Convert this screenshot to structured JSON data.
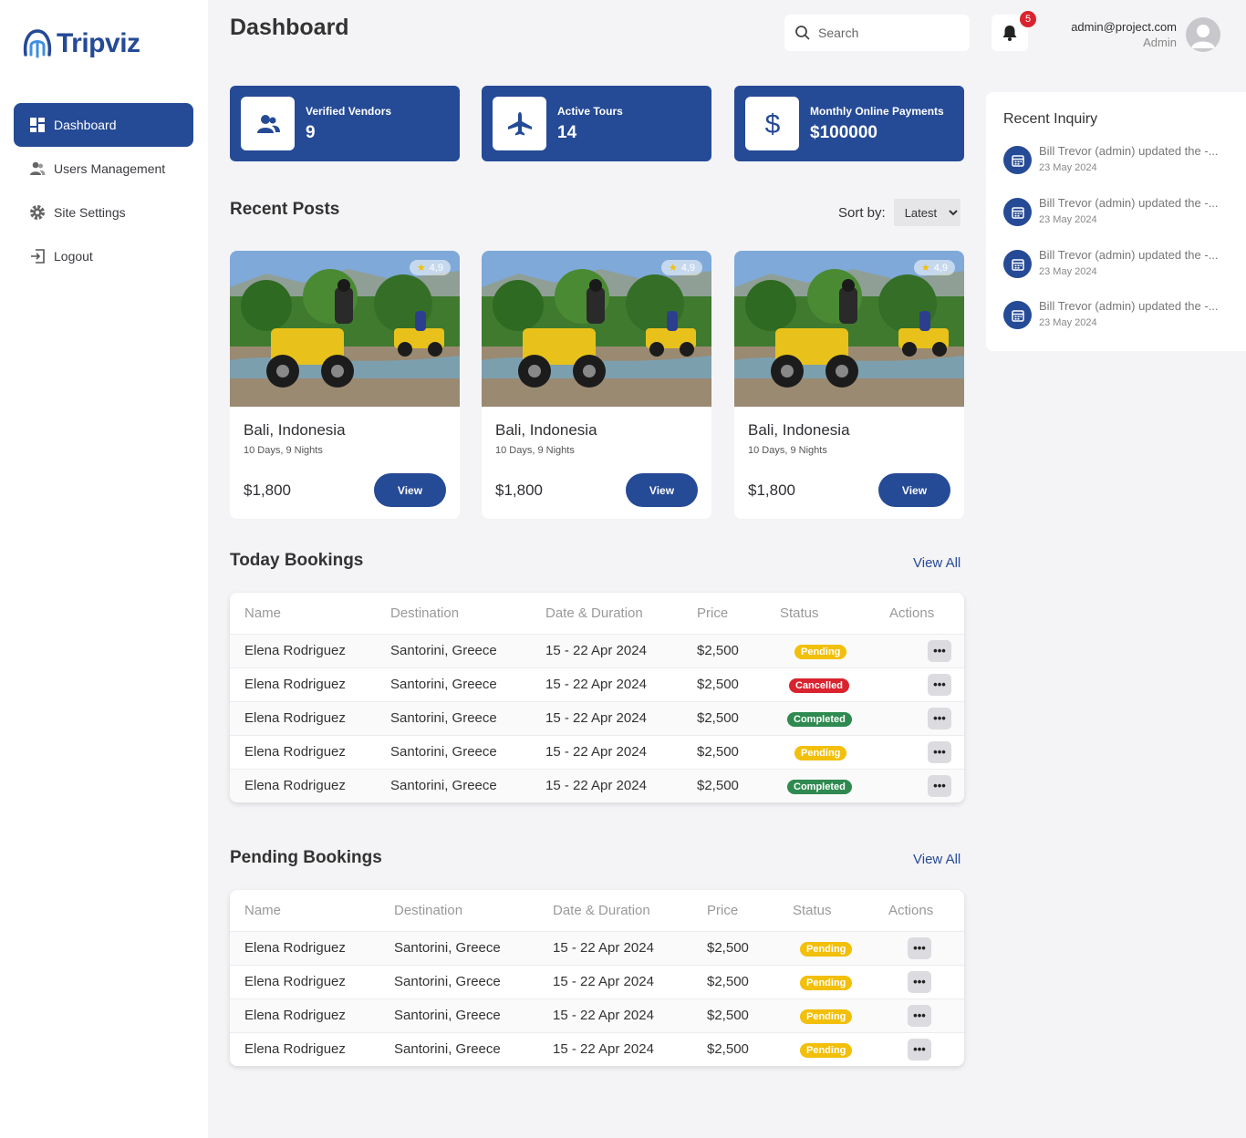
{
  "app": {
    "name": "Tripviz"
  },
  "sidebar": {
    "items": [
      {
        "label": "Dashboard",
        "icon": "dashboard-icon",
        "active": true
      },
      {
        "label": "Users Management",
        "icon": "users-icon"
      },
      {
        "label": "Site Settings",
        "icon": "gear-icon"
      },
      {
        "label": "Logout",
        "icon": "logout-icon"
      }
    ]
  },
  "header": {
    "title": "Dashboard",
    "search_placeholder": "Search",
    "notification_count": "5",
    "user_email": "admin@project.com",
    "user_role": "Admin"
  },
  "stats": [
    {
      "label": "Verified Vendors",
      "value": "9",
      "icon": "users-icon"
    },
    {
      "label": "Active Tours",
      "value": "14",
      "icon": "airplane-icon"
    },
    {
      "label": "Monthly Online Payments",
      "value": "$100000",
      "icon": "dollar-icon"
    }
  ],
  "recent_posts": {
    "title": "Recent Posts",
    "sort_label": "Sort by:",
    "sort_value": "Latest",
    "posts": [
      {
        "rating": "4,9",
        "title": "Bali, Indonesia",
        "meta": "10 Days, 9 Nights",
        "price": "$1,800",
        "button": "View"
      },
      {
        "rating": "4,9",
        "title": "Bali, Indonesia",
        "meta": "10 Days, 9 Nights",
        "price": "$1,800",
        "button": "View"
      },
      {
        "rating": "4,9",
        "title": "Bali, Indonesia",
        "meta": "10 Days, 9 Nights",
        "price": "$1,800",
        "button": "View"
      }
    ]
  },
  "today_bookings": {
    "title": "Today Bookings",
    "view_all": "View All",
    "columns": [
      "Name",
      "Destination",
      "Date & Duration",
      "Price",
      "Status",
      "Actions"
    ],
    "rows": [
      {
        "name": "Elena Rodriguez",
        "destination": "Santorini, Greece",
        "date": "15 - 22 Apr 2024",
        "price": "$2,500",
        "status": "Pending"
      },
      {
        "name": "Elena Rodriguez",
        "destination": "Santorini, Greece",
        "date": "15 - 22 Apr 2024",
        "price": "$2,500",
        "status": "Cancelled"
      },
      {
        "name": "Elena Rodriguez",
        "destination": "Santorini, Greece",
        "date": "15 - 22 Apr 2024",
        "price": "$2,500",
        "status": "Completed"
      },
      {
        "name": "Elena Rodriguez",
        "destination": "Santorini, Greece",
        "date": "15 - 22 Apr 2024",
        "price": "$2,500",
        "status": "Pending"
      },
      {
        "name": "Elena Rodriguez",
        "destination": "Santorini, Greece",
        "date": "15 - 22 Apr 2024",
        "price": "$2,500",
        "status": "Completed"
      }
    ]
  },
  "pending_bookings": {
    "title": "Pending Bookings",
    "view_all": "View All",
    "columns": [
      "Name",
      "Destination",
      "Date & Duration",
      "Price",
      "Status",
      "Actions"
    ],
    "rows": [
      {
        "name": "Elena Rodriguez",
        "destination": "Santorini, Greece",
        "date": "15 - 22 Apr 2024",
        "price": "$2,500",
        "status": "Pending"
      },
      {
        "name": "Elena Rodriguez",
        "destination": "Santorini, Greece",
        "date": "15 - 22 Apr 2024",
        "price": "$2,500",
        "status": "Pending"
      },
      {
        "name": "Elena Rodriguez",
        "destination": "Santorini, Greece",
        "date": "15 - 22 Apr 2024",
        "price": "$2,500",
        "status": "Pending"
      },
      {
        "name": "Elena Rodriguez",
        "destination": "Santorini, Greece",
        "date": "15 - 22 Apr 2024",
        "price": "$2,500",
        "status": "Pending"
      }
    ]
  },
  "recent_inquiry": {
    "title": "Recent Inquiry",
    "items": [
      {
        "text": "Bill Trevor (admin) updated the -...",
        "date": "23 May 2024"
      },
      {
        "text": "Bill Trevor (admin) updated the -...",
        "date": "23 May 2024"
      },
      {
        "text": "Bill Trevor (admin) updated the -...",
        "date": "23 May 2024"
      },
      {
        "text": "Bill Trevor (admin) updated the -...",
        "date": "23 May 2024"
      }
    ]
  },
  "colors": {
    "brand": "#254a96",
    "pending": "#f2bf0a",
    "cancelled": "#d9232e",
    "completed": "#2e8a50"
  }
}
